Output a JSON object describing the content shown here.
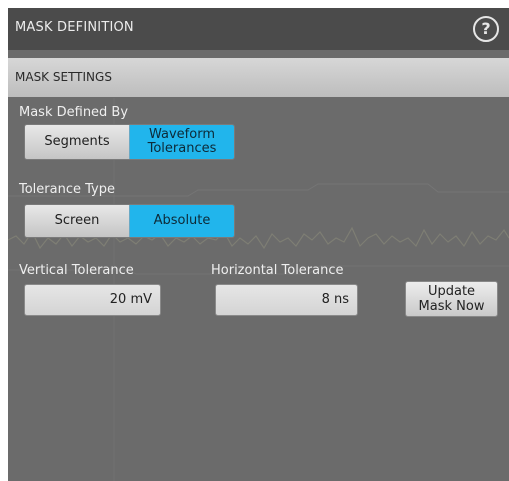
{
  "header": {
    "title": "MASK DEFINITION",
    "help_glyph": "?"
  },
  "section": {
    "title": "MASK SETTINGS"
  },
  "mask_defined_by": {
    "label": "Mask Defined By",
    "options": [
      "Segments",
      "Waveform Tolerances"
    ],
    "selected": "Waveform Tolerances"
  },
  "tolerance_type": {
    "label": "Tolerance Type",
    "options": [
      "Screen",
      "Absolute"
    ],
    "selected": "Absolute"
  },
  "vertical_tolerance": {
    "label": "Vertical Tolerance",
    "value": "20 mV"
  },
  "horizontal_tolerance": {
    "label": "Horizontal Tolerance",
    "value": "8 ns"
  },
  "update_button": {
    "label_line1": "Update",
    "label_line2": "Mask Now"
  },
  "colors": {
    "selected": "#21b5ec",
    "panel": "#6b6b6b",
    "header": "#4b4b4b"
  }
}
